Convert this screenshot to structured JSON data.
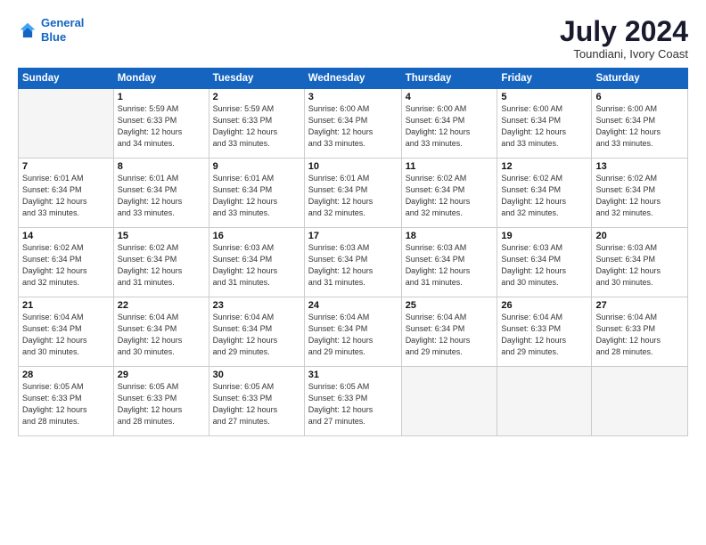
{
  "header": {
    "logo_line1": "General",
    "logo_line2": "Blue",
    "month_year": "July 2024",
    "location": "Toundiani, Ivory Coast"
  },
  "weekdays": [
    "Sunday",
    "Monday",
    "Tuesday",
    "Wednesday",
    "Thursday",
    "Friday",
    "Saturday"
  ],
  "weeks": [
    [
      {
        "day": "",
        "info": ""
      },
      {
        "day": "1",
        "info": "Sunrise: 5:59 AM\nSunset: 6:33 PM\nDaylight: 12 hours\nand 34 minutes."
      },
      {
        "day": "2",
        "info": "Sunrise: 5:59 AM\nSunset: 6:33 PM\nDaylight: 12 hours\nand 33 minutes."
      },
      {
        "day": "3",
        "info": "Sunrise: 6:00 AM\nSunset: 6:34 PM\nDaylight: 12 hours\nand 33 minutes."
      },
      {
        "day": "4",
        "info": "Sunrise: 6:00 AM\nSunset: 6:34 PM\nDaylight: 12 hours\nand 33 minutes."
      },
      {
        "day": "5",
        "info": "Sunrise: 6:00 AM\nSunset: 6:34 PM\nDaylight: 12 hours\nand 33 minutes."
      },
      {
        "day": "6",
        "info": "Sunrise: 6:00 AM\nSunset: 6:34 PM\nDaylight: 12 hours\nand 33 minutes."
      }
    ],
    [
      {
        "day": "7",
        "info": "Sunrise: 6:01 AM\nSunset: 6:34 PM\nDaylight: 12 hours\nand 33 minutes."
      },
      {
        "day": "8",
        "info": "Sunrise: 6:01 AM\nSunset: 6:34 PM\nDaylight: 12 hours\nand 33 minutes."
      },
      {
        "day": "9",
        "info": "Sunrise: 6:01 AM\nSunset: 6:34 PM\nDaylight: 12 hours\nand 33 minutes."
      },
      {
        "day": "10",
        "info": "Sunrise: 6:01 AM\nSunset: 6:34 PM\nDaylight: 12 hours\nand 32 minutes."
      },
      {
        "day": "11",
        "info": "Sunrise: 6:02 AM\nSunset: 6:34 PM\nDaylight: 12 hours\nand 32 minutes."
      },
      {
        "day": "12",
        "info": "Sunrise: 6:02 AM\nSunset: 6:34 PM\nDaylight: 12 hours\nand 32 minutes."
      },
      {
        "day": "13",
        "info": "Sunrise: 6:02 AM\nSunset: 6:34 PM\nDaylight: 12 hours\nand 32 minutes."
      }
    ],
    [
      {
        "day": "14",
        "info": "Sunrise: 6:02 AM\nSunset: 6:34 PM\nDaylight: 12 hours\nand 32 minutes."
      },
      {
        "day": "15",
        "info": "Sunrise: 6:02 AM\nSunset: 6:34 PM\nDaylight: 12 hours\nand 31 minutes."
      },
      {
        "day": "16",
        "info": "Sunrise: 6:03 AM\nSunset: 6:34 PM\nDaylight: 12 hours\nand 31 minutes."
      },
      {
        "day": "17",
        "info": "Sunrise: 6:03 AM\nSunset: 6:34 PM\nDaylight: 12 hours\nand 31 minutes."
      },
      {
        "day": "18",
        "info": "Sunrise: 6:03 AM\nSunset: 6:34 PM\nDaylight: 12 hours\nand 31 minutes."
      },
      {
        "day": "19",
        "info": "Sunrise: 6:03 AM\nSunset: 6:34 PM\nDaylight: 12 hours\nand 30 minutes."
      },
      {
        "day": "20",
        "info": "Sunrise: 6:03 AM\nSunset: 6:34 PM\nDaylight: 12 hours\nand 30 minutes."
      }
    ],
    [
      {
        "day": "21",
        "info": "Sunrise: 6:04 AM\nSunset: 6:34 PM\nDaylight: 12 hours\nand 30 minutes."
      },
      {
        "day": "22",
        "info": "Sunrise: 6:04 AM\nSunset: 6:34 PM\nDaylight: 12 hours\nand 30 minutes."
      },
      {
        "day": "23",
        "info": "Sunrise: 6:04 AM\nSunset: 6:34 PM\nDaylight: 12 hours\nand 29 minutes."
      },
      {
        "day": "24",
        "info": "Sunrise: 6:04 AM\nSunset: 6:34 PM\nDaylight: 12 hours\nand 29 minutes."
      },
      {
        "day": "25",
        "info": "Sunrise: 6:04 AM\nSunset: 6:34 PM\nDaylight: 12 hours\nand 29 minutes."
      },
      {
        "day": "26",
        "info": "Sunrise: 6:04 AM\nSunset: 6:33 PM\nDaylight: 12 hours\nand 29 minutes."
      },
      {
        "day": "27",
        "info": "Sunrise: 6:04 AM\nSunset: 6:33 PM\nDaylight: 12 hours\nand 28 minutes."
      }
    ],
    [
      {
        "day": "28",
        "info": "Sunrise: 6:05 AM\nSunset: 6:33 PM\nDaylight: 12 hours\nand 28 minutes."
      },
      {
        "day": "29",
        "info": "Sunrise: 6:05 AM\nSunset: 6:33 PM\nDaylight: 12 hours\nand 28 minutes."
      },
      {
        "day": "30",
        "info": "Sunrise: 6:05 AM\nSunset: 6:33 PM\nDaylight: 12 hours\nand 27 minutes."
      },
      {
        "day": "31",
        "info": "Sunrise: 6:05 AM\nSunset: 6:33 PM\nDaylight: 12 hours\nand 27 minutes."
      },
      {
        "day": "",
        "info": ""
      },
      {
        "day": "",
        "info": ""
      },
      {
        "day": "",
        "info": ""
      }
    ]
  ]
}
